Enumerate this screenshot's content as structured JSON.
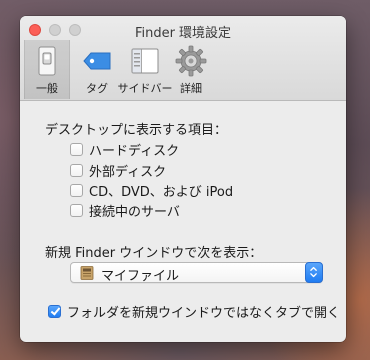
{
  "window": {
    "title": "Finder 環境設定"
  },
  "tabs": [
    {
      "label": "一般",
      "icon": "general-switch-icon",
      "selected": true
    },
    {
      "label": "タグ",
      "icon": "tag-icon",
      "selected": false
    },
    {
      "label": "サイドバー",
      "icon": "sidebar-icon",
      "selected": false
    },
    {
      "label": "詳細",
      "icon": "gear-icon",
      "selected": false
    }
  ],
  "desktop_section": {
    "title": "デスクトップに表示する項目：",
    "items": [
      {
        "label": "ハードディスク",
        "checked": false
      },
      {
        "label": "外部ディスク",
        "checked": false
      },
      {
        "label": "CD、DVD、および iPod",
        "checked": false
      },
      {
        "label": "接続中のサーバ",
        "checked": false
      }
    ]
  },
  "new_window": {
    "title": "新規 Finder ウインドウで次を表示：",
    "selected_value": "マイファイル",
    "icon": "my-files-icon"
  },
  "open_folders_in_new_window": {
    "label": "フォルダを新規ウインドウではなくタブで開く",
    "checked": true
  },
  "colors": {
    "accent": "#1f7cf2",
    "close_button": "#fc5f57"
  }
}
